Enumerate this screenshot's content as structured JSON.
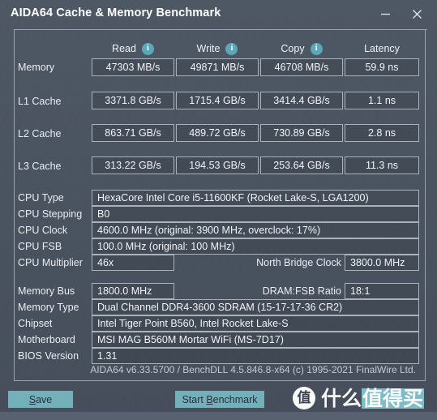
{
  "window": {
    "title": "AIDA64 Cache & Memory Benchmark",
    "minimize_label": "−",
    "close_label": "×"
  },
  "benchmark": {
    "headers": [
      {
        "label": "Read",
        "info": "i"
      },
      {
        "label": "Write",
        "info": "i"
      },
      {
        "label": "Copy",
        "info": "i"
      },
      {
        "label": "Latency",
        "info": ""
      }
    ],
    "rows": [
      {
        "label": "Memory",
        "read": "47303 MB/s",
        "write": "49871 MB/s",
        "copy": "46708 MB/s",
        "latency": "59.9 ns"
      },
      {
        "label": "L1 Cache",
        "read": "3371.8 GB/s",
        "write": "1715.4 GB/s",
        "copy": "3414.4 GB/s",
        "latency": "1.1 ns"
      },
      {
        "label": "L2 Cache",
        "read": "863.71 GB/s",
        "write": "489.72 GB/s",
        "copy": "730.89 GB/s",
        "latency": "2.8 ns"
      },
      {
        "label": "L3 Cache",
        "read": "313.22 GB/s",
        "write": "194.53 GB/s",
        "copy": "253.64 GB/s",
        "latency": "11.3 ns"
      }
    ]
  },
  "cpu_info": {
    "cpu_type_label": "CPU Type",
    "cpu_type_value": "HexaCore Intel Core i5-11600KF  (Rocket Lake-S, LGA1200)",
    "cpu_stepping_label": "CPU Stepping",
    "cpu_stepping_value": "B0",
    "cpu_clock_label": "CPU Clock",
    "cpu_clock_value": "4600.0 MHz  (original: 3900 MHz, overclock: 17%)",
    "cpu_fsb_label": "CPU FSB",
    "cpu_fsb_value": "100.0 MHz  (original: 100 MHz)",
    "cpu_multiplier_label": "CPU Multiplier",
    "cpu_multiplier_value": "46x",
    "north_bridge_label": "North Bridge Clock",
    "north_bridge_value": "3800.0 MHz"
  },
  "memory_info": {
    "memory_bus_label": "Memory Bus",
    "memory_bus_value": "1800.0 MHz",
    "dram_fsb_label": "DRAM:FSB Ratio",
    "dram_fsb_value": "18:1",
    "memory_type_label": "Memory Type",
    "memory_type_value": "Dual Channel DDR4-3600 SDRAM  (15-17-17-36 CR2)",
    "chipset_label": "Chipset",
    "chipset_value": "Intel Tiger Point B560, Intel Rocket Lake-S",
    "motherboard_label": "Motherboard",
    "motherboard_value": "MSI MAG B560M Mortar WiFi (MS-7D17)",
    "bios_label": "BIOS Version",
    "bios_value": "1.31"
  },
  "footer": {
    "version_text": "AIDA64 v6.33.5700 / BenchDLL 4.5.846.8-x64  (c) 1995-2021 FinalWire Ltd.",
    "save_prefix": "",
    "save_accel": "S",
    "save_suffix": "ave",
    "bench_prefix": "Start ",
    "bench_accel": "B",
    "bench_suffix": "enchmark"
  },
  "watermark": {
    "badge": "值",
    "text_plain": "什么",
    "text_highlight": "值得买"
  },
  "colors": {
    "accent_teal": "#73b0ba",
    "info_icon": "#5aa8b8",
    "panel_border": "#9aa3ae",
    "window_bg": "#49525f"
  }
}
